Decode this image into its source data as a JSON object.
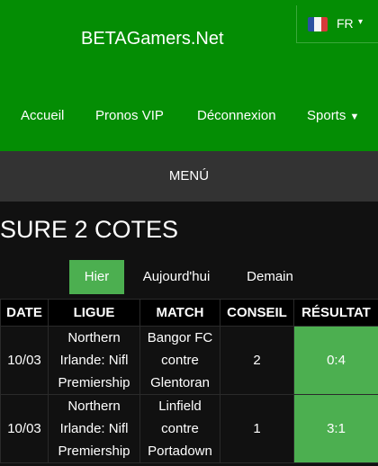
{
  "header": {
    "brand": "BETAGamers.Net",
    "language": {
      "code": "FR",
      "flag_colors": [
        "#2b4fa0",
        "#f4f4f4",
        "#d63a3a"
      ]
    },
    "nav": [
      {
        "label": "Accueil"
      },
      {
        "label": "Pronos VIP"
      },
      {
        "label": "Déconnexion"
      },
      {
        "label": "Sports",
        "icon": "caret-down-icon"
      }
    ]
  },
  "menu": {
    "label": "MENÚ"
  },
  "page": {
    "title": "SURE 2 COTES"
  },
  "tabs": [
    {
      "label": "Hier",
      "active": true
    },
    {
      "label": "Aujourd'hui",
      "active": false
    },
    {
      "label": "Demain",
      "active": false
    }
  ],
  "table": {
    "headers": [
      "DATE",
      "LIGUE",
      "MATCH",
      "CONSEIL",
      "RÉSULTAT"
    ],
    "rows": [
      {
        "date": "10/03",
        "league": [
          "Northern",
          "Irlande: Nifl",
          "Premiership"
        ],
        "match": [
          "Bangor FC",
          "contre",
          "Glentoran"
        ],
        "tip": "2",
        "result": "0:4"
      },
      {
        "date": "10/03",
        "league": [
          "Northern",
          "Irlande: Nifl",
          "Premiership"
        ],
        "match": [
          "Linfield",
          "contre",
          "Portadown"
        ],
        "tip": "1",
        "result": "3:1"
      }
    ]
  },
  "colors": {
    "header_green": "#048d04",
    "menu_bar": "#333333",
    "accent_green": "#4caf50",
    "background": "#111111"
  }
}
